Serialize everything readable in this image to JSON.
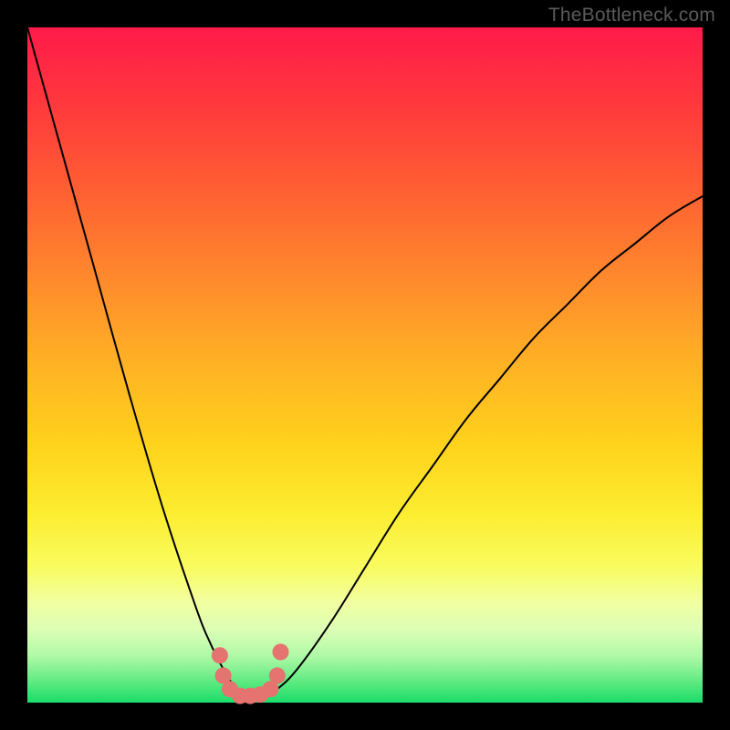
{
  "watermark_text": "TheBottleneck.com",
  "chart_data": {
    "type": "line",
    "title": "",
    "xlabel": "",
    "ylabel": "",
    "xlim": [
      0,
      100
    ],
    "ylim": [
      0,
      100
    ],
    "series": [
      {
        "name": "bottleneck-curve",
        "x": [
          0,
          5,
          10,
          15,
          20,
          25,
          27,
          29,
          31,
          33,
          35,
          37,
          40,
          45,
          50,
          55,
          60,
          65,
          70,
          75,
          80,
          85,
          90,
          95,
          100
        ],
        "y": [
          100,
          82,
          64,
          46,
          29,
          14,
          9,
          5,
          2,
          1,
          1,
          2,
          5,
          12,
          20,
          28,
          35,
          42,
          48,
          54,
          59,
          64,
          68,
          72,
          75
        ]
      }
    ],
    "markers": [
      {
        "x": 28.5,
        "y": 7.0
      },
      {
        "x": 29.0,
        "y": 4.0
      },
      {
        "x": 30.0,
        "y": 2.0
      },
      {
        "x": 31.5,
        "y": 1.0
      },
      {
        "x": 33.0,
        "y": 1.0
      },
      {
        "x": 34.5,
        "y": 1.2
      },
      {
        "x": 36.0,
        "y": 2.0
      },
      {
        "x": 37.0,
        "y": 4.0
      },
      {
        "x": 37.5,
        "y": 7.5
      }
    ],
    "background": {
      "type": "vertical-gradient",
      "stops": [
        {
          "pos": 0.0,
          "color": "#ff1b4a"
        },
        {
          "pos": 0.25,
          "color": "#ff6232"
        },
        {
          "pos": 0.5,
          "color": "#ffb224"
        },
        {
          "pos": 0.72,
          "color": "#fced30"
        },
        {
          "pos": 0.85,
          "color": "#f2ff9f"
        },
        {
          "pos": 1.0,
          "color": "#1bdc6b"
        }
      ]
    },
    "marker_color": "#e5736f",
    "line_color": "#000000"
  }
}
